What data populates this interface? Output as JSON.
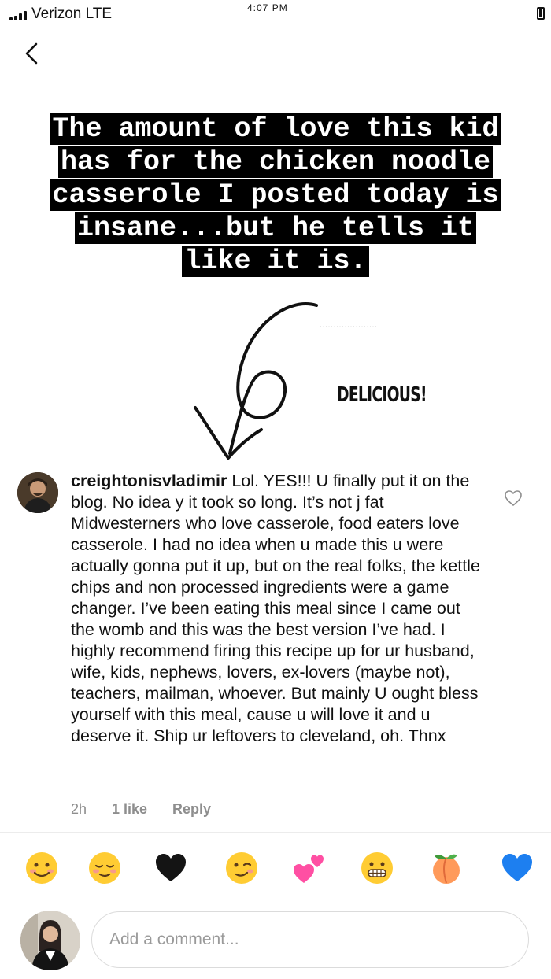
{
  "status_bar": {
    "carrier": "Verizon  LTE",
    "time": "4:07 PM"
  },
  "story": {
    "caption_lines": [
      "The amount of love this kid",
      "has for the chicken noodle",
      "casserole I posted today is",
      "insane...but he tells it",
      "like it is."
    ],
    "sticker_text": "DELICIOUS!"
  },
  "comment": {
    "username": "creightonisvladimir",
    "text": "Lol. YES!!! U finally put it on the blog. No idea y it took so long. It’s not j fat Midwesterners who love casserole, food eaters love casserole. I had no idea when u made this u were actually gonna put it up, but on the real folks, the kettle chips and non processed ingredients were a game changer. I’ve been eating this meal since I came out the womb and this was the best version I’ve had. I highly recommend firing this recipe up for ur husband, wife, kids, nephews, lovers, ex-lovers (maybe not), teachers, mailman, whoever. But mainly U ought bless yourself with this meal, cause u will love it and u deserve it. Ship ur leftovers to cleveland, oh. Thnx",
    "time": "2h",
    "likes": "1 like",
    "reply_label": "Reply"
  },
  "emoji_bar": [
    "smiling-face-icon",
    "relieved-face-icon",
    "black-heart-icon",
    "winking-face-icon",
    "two-hearts-icon",
    "grimacing-face-icon",
    "peach-icon",
    "blue-heart-icon"
  ],
  "composer": {
    "placeholder": "Add a comment..."
  },
  "colors": {
    "muted_text": "#8e8e8e",
    "caption_bg": "#000000",
    "input_border": "#dbdbdb"
  }
}
